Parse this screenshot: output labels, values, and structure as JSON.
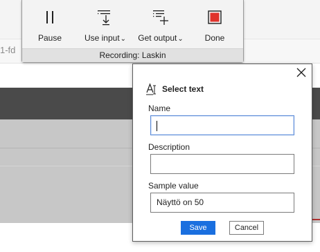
{
  "background": {
    "url_fragment": "1-fd"
  },
  "toolbar": {
    "pause_label": "Pause",
    "use_input_label": "Use input",
    "get_output_label": "Get output",
    "done_label": "Done",
    "status_text": "Recording: Laskin",
    "done_color": "#e0322b",
    "pause_icon": "pause-icon",
    "use_input_icon": "use-input-icon",
    "get_output_icon": "get-output-icon",
    "done_icon": "stop-icon"
  },
  "dialog": {
    "title": "Select text",
    "title_icon": "text-select-icon",
    "close_icon": "close-icon",
    "name_label": "Name",
    "name_value": "",
    "description_label": "Description",
    "description_value": "",
    "sample_label": "Sample value",
    "sample_value": "Näyttö on 50",
    "save_label": "Save",
    "cancel_label": "Cancel",
    "accent_color": "#1a6fdf"
  }
}
